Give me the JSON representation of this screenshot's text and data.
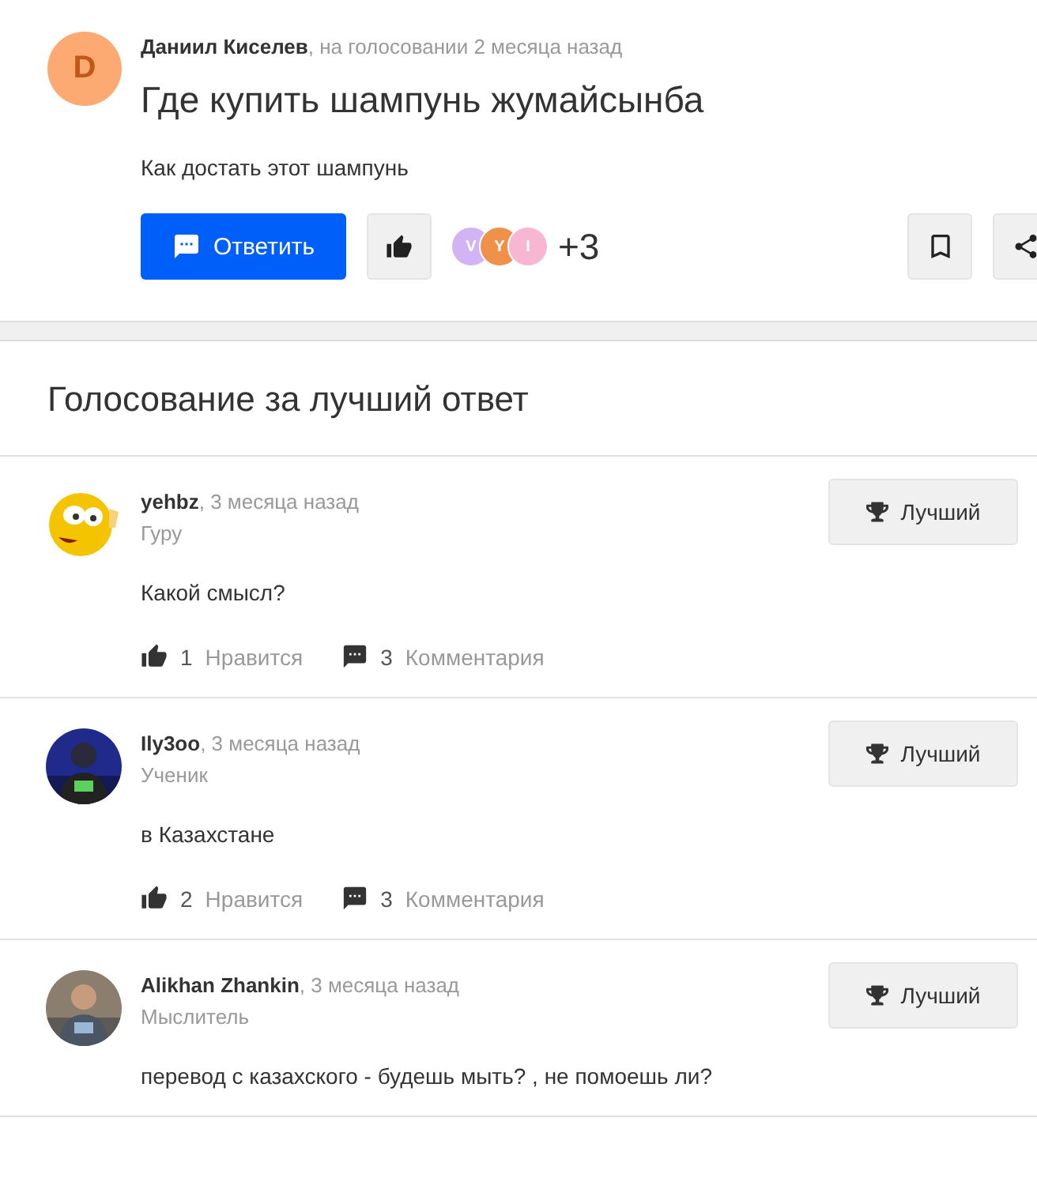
{
  "question": {
    "avatar_letter": "D",
    "author": "Даниил Киселев",
    "meta": ", на голосовании 2 месяца назад",
    "title": "Где купить шампунь жумайсынба",
    "body": "Как достать этот шампунь",
    "reply_button": "Ответить",
    "voters": [
      {
        "letter": "V",
        "color": "#d2b4f5"
      },
      {
        "letter": "Y",
        "color": "#f0914a"
      },
      {
        "letter": "I",
        "color": "#f7b6d2"
      }
    ],
    "voters_more": "+3"
  },
  "voting": {
    "title": "Голосование за лучший ответ",
    "answers": [
      {
        "author": "yehbz",
        "meta": ", 3 месяца назад",
        "rank": "Гуру",
        "avatar": {
          "kind": "emoji"
        },
        "text": "Какой смысл?",
        "likes": "1",
        "likes_label": "Нравится",
        "comments": "3",
        "comments_label": "Комментария",
        "best_button": "Лучший"
      },
      {
        "author": "Ily3oo",
        "meta": ", 3 месяца назад",
        "rank": "Ученик",
        "text": "в Казахстане",
        "likes": "2",
        "likes_label": "Нравится",
        "comments": "3",
        "comments_label": "Комментария",
        "best_button": "Лучший"
      },
      {
        "author": "Alikhan Zhankin",
        "meta": ", 3 месяца назад",
        "rank": "Мыслитель",
        "text": "перевод с казахского - будешь мыть? , не помоешь ли?",
        "best_button": "Лучший"
      }
    ]
  }
}
